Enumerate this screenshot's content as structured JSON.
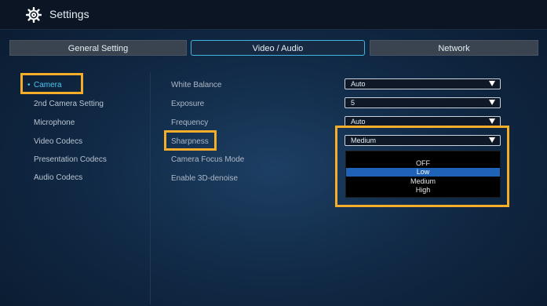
{
  "window": {
    "title": "Settings"
  },
  "tabs": [
    {
      "label": "General Setting",
      "active": false
    },
    {
      "label": "Video / Audio",
      "active": true
    },
    {
      "label": "Network",
      "active": false
    }
  ],
  "sidebar": {
    "bullet": "•",
    "items": [
      {
        "label": "Camera",
        "active": true
      },
      {
        "label": "2nd Camera Setting",
        "active": false
      },
      {
        "label": "Microphone",
        "active": false
      },
      {
        "label": "Video Codecs",
        "active": false
      },
      {
        "label": "Presentation Codecs",
        "active": false
      },
      {
        "label": "Audio Codecs",
        "active": false
      }
    ]
  },
  "settings": {
    "white_balance": {
      "label": "White Balance",
      "value": "Auto"
    },
    "exposure": {
      "label": "Exposure",
      "value": "5"
    },
    "frequency": {
      "label": "Frequency",
      "value": "Auto"
    },
    "sharpness": {
      "label": "Sharpness",
      "value": "Medium",
      "options": [
        "OFF",
        "Low",
        "Medium",
        "High"
      ],
      "highlighted_option": "Low"
    },
    "camera_focus_mode": {
      "label": "Camera Focus Mode"
    },
    "enable_3d_denoise": {
      "label": "Enable 3D-denoise"
    }
  },
  "colors": {
    "accent": "#4cc4f2",
    "highlight_box": "#f6ad2a",
    "selected_option": "#1f63b9"
  },
  "icons": {
    "settings": "gear-icon",
    "dropdown": "triangle-down-icon"
  }
}
